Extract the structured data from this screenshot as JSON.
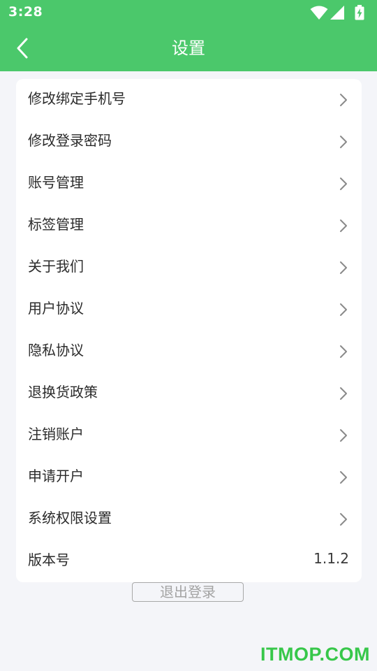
{
  "status_bar": {
    "time": "3:28",
    "icons": [
      "wifi-icon",
      "signal-icon",
      "battery-charging-icon"
    ]
  },
  "header": {
    "title": "设置",
    "back_icon": "chevron-left-icon",
    "background_color": "#4bc86b"
  },
  "menu": {
    "items": [
      {
        "label": "修改绑定手机号"
      },
      {
        "label": "修改登录密码"
      },
      {
        "label": "账号管理"
      },
      {
        "label": "标签管理"
      },
      {
        "label": "关于我们"
      },
      {
        "label": "用户协议"
      },
      {
        "label": "隐私协议"
      },
      {
        "label": "退换货政策"
      },
      {
        "label": "注销账户"
      },
      {
        "label": "申请开户"
      },
      {
        "label": "系统权限设置"
      }
    ],
    "version": {
      "label": "版本号",
      "value": "1.1.2"
    }
  },
  "logout": {
    "label": "退出登录"
  },
  "watermark": {
    "text": "ITMOP.COM",
    "color": "#37c74a"
  }
}
